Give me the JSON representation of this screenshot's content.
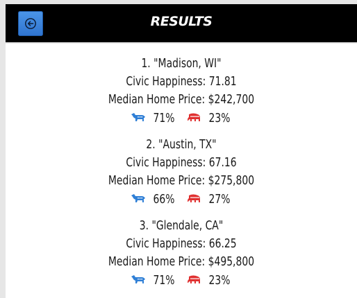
{
  "header": {
    "title": "RESULTS"
  },
  "colors": {
    "democrat": "#2f7fd6",
    "republican": "#e03131",
    "back_button": "#3a86e0"
  },
  "results": [
    {
      "rank_city": "1. \"Madison, WI\"",
      "civic_happiness": "Civic Happiness: 71.81",
      "median_home_price": "Median Home Price: $242,700",
      "dem_pct": "71%",
      "rep_pct": "23%"
    },
    {
      "rank_city": "2. \"Austin, TX\"",
      "civic_happiness": "Civic Happiness: 67.16",
      "median_home_price": "Median Home Price: $275,800",
      "dem_pct": "66%",
      "rep_pct": "27%"
    },
    {
      "rank_city": "3. \"Glendale, CA\"",
      "civic_happiness": "Civic Happiness: 66.25",
      "median_home_price": "Median Home Price: $495,800",
      "dem_pct": "71%",
      "rep_pct": "23%"
    }
  ]
}
